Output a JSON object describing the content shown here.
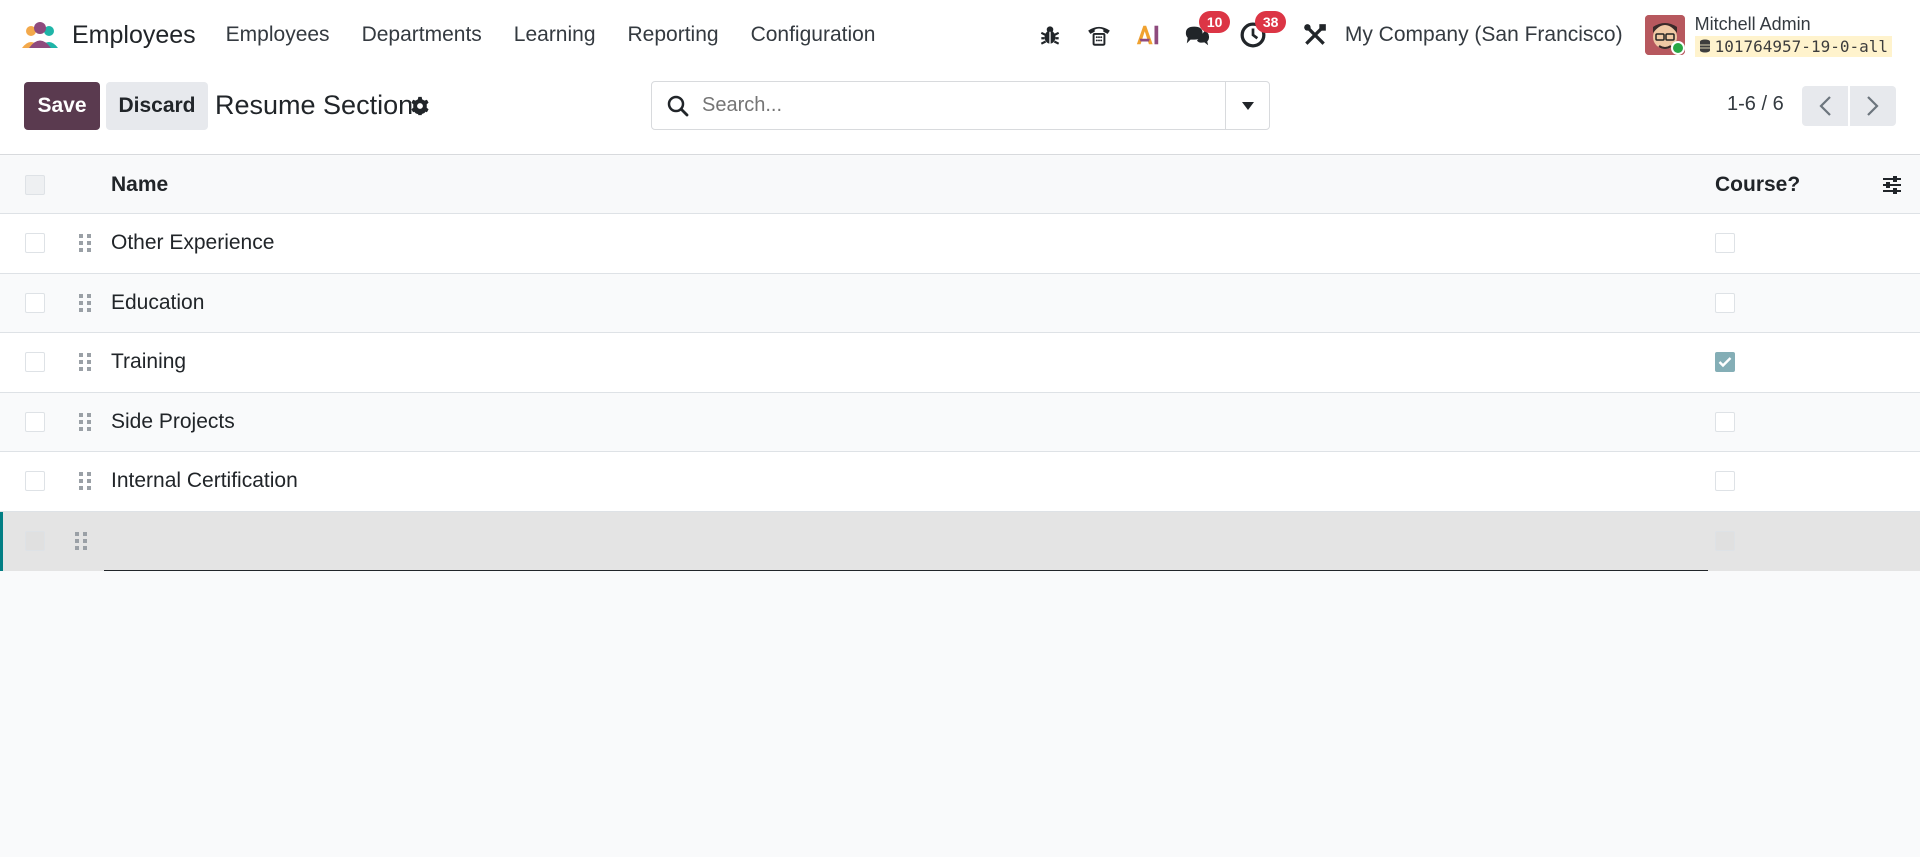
{
  "app": {
    "name": "Employees"
  },
  "menu": [
    "Employees",
    "Departments",
    "Learning",
    "Reporting",
    "Configuration"
  ],
  "systray": {
    "messages_count": "10",
    "activities_count": "38",
    "company": "My Company (San Francisco)",
    "user_name": "Mitchell Admin",
    "database": "101764957-19-0-all"
  },
  "controls": {
    "save_label": "Save",
    "discard_label": "Discard",
    "title": "Resume Sections",
    "search_placeholder": "Search...",
    "pager": "1-6 / 6"
  },
  "list": {
    "columns": {
      "name": "Name",
      "course": "Course?"
    },
    "rows": [
      {
        "name": "Other Experience",
        "course": false
      },
      {
        "name": "Education",
        "course": false
      },
      {
        "name": "Training",
        "course": true
      },
      {
        "name": "Side Projects",
        "course": false
      },
      {
        "name": "Internal Certification",
        "course": false
      },
      {
        "name": "",
        "course": false
      }
    ]
  },
  "colors": {
    "primary": "#5a3a4f",
    "badge": "#dc3545",
    "accent": "#017e84",
    "checked": "#84aeb6"
  }
}
